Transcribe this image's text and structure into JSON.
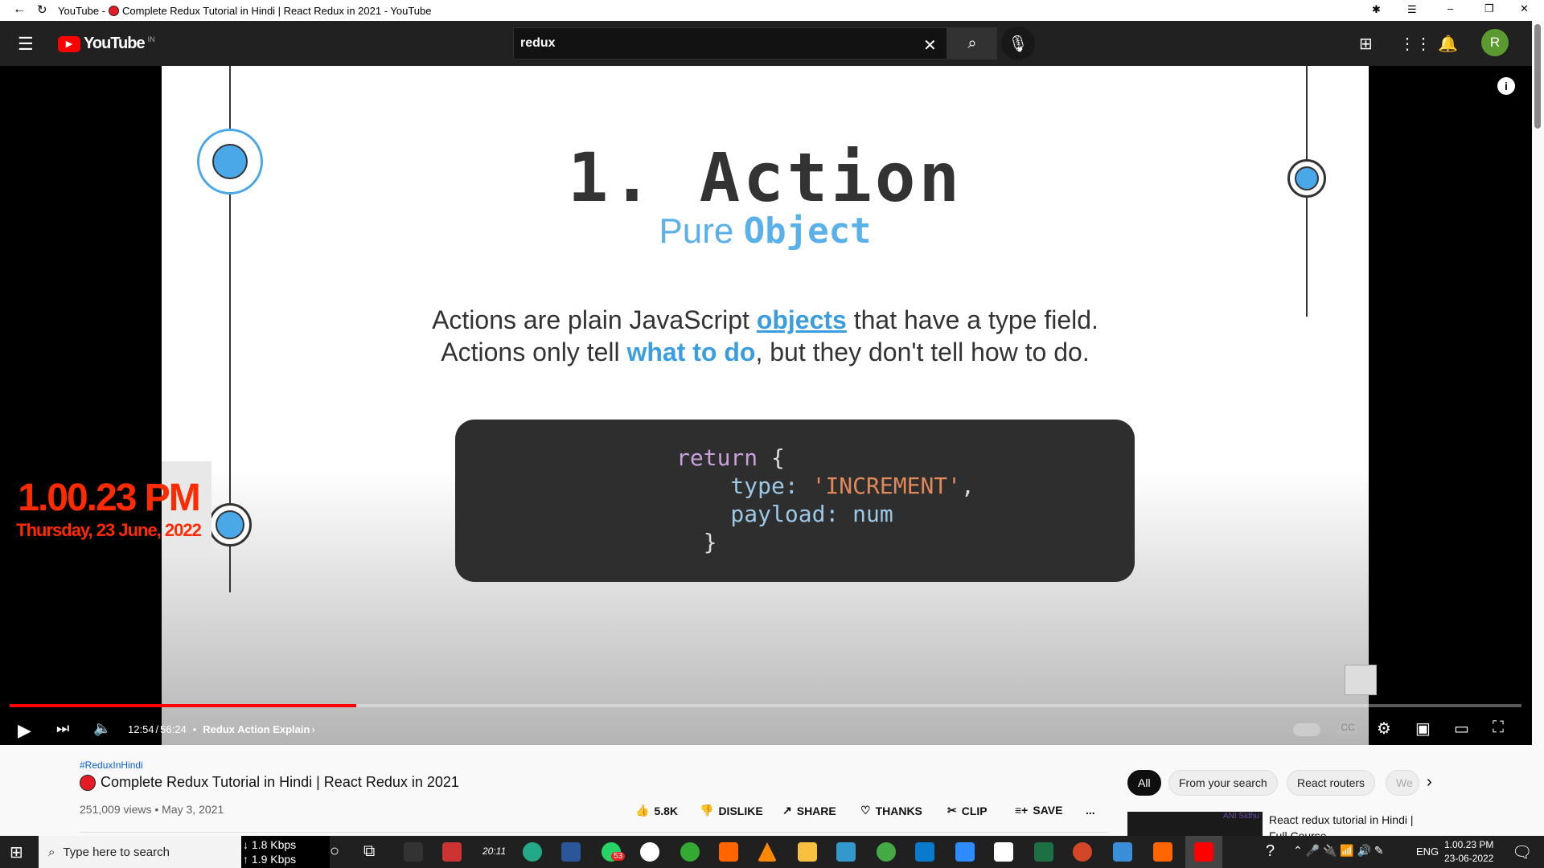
{
  "browser": {
    "tab_title": "YouTube - ",
    "title_rest": "Complete Redux Tutorial in Hindi | React Redux in 2021 - YouTube"
  },
  "header": {
    "logo": "YouTube",
    "region": "IN",
    "search_value": "redux",
    "avatar": "R"
  },
  "slide": {
    "heading": "1. Action",
    "sub_plain": "Pure ",
    "sub_bold": "Object",
    "line1": [
      "Actions are plain JavaScript ",
      "objects",
      " that have a type field."
    ],
    "line2": [
      "Actions only tell ",
      "what to do",
      ", but they don't tell how to do."
    ],
    "code": {
      "kw": "return",
      "brace_open": " {",
      "k1": "    type: ",
      "v1": "'INCREMENT'",
      "c1": ",",
      "k2": "    payload: ",
      "v2": "num",
      "brace_close": "  }"
    }
  },
  "overlay": {
    "time": "1.00.23 PM",
    "date": "Thursday, 23 June, 2022"
  },
  "player": {
    "current": "12:54",
    "duration": "56:24",
    "separator": " / ",
    "chapter": "Redux Action Explain",
    "progress": 0.229
  },
  "video": {
    "hashtag": "#ReduxInHindi",
    "title": "Complete Redux Tutorial in Hindi | React Redux in 2021",
    "meta": "251,009 views • May 3, 2021",
    "actions": {
      "like": "5.8K",
      "dislike": "DISLIKE",
      "share": "SHARE",
      "thanks": "THANKS",
      "clip": "CLIP",
      "save": "SAVE",
      "more": "..."
    }
  },
  "chips": [
    "All",
    "From your search",
    "React routers",
    "We"
  ],
  "related": {
    "title": "React redux tutorial in Hindi |",
    "title2": "Full Course",
    "thumb_label": "ANI Sidhu"
  },
  "taskbar": {
    "search_placeholder": "Type here to search",
    "down": "↓ 1.8 Kbps",
    "up": "↑ 1.9 Kbps",
    "clock_widget": "20:11",
    "whatsapp_badge": "53",
    "lang": "ENG",
    "time": "1.00.23 PM",
    "date": "23-06-2022"
  }
}
